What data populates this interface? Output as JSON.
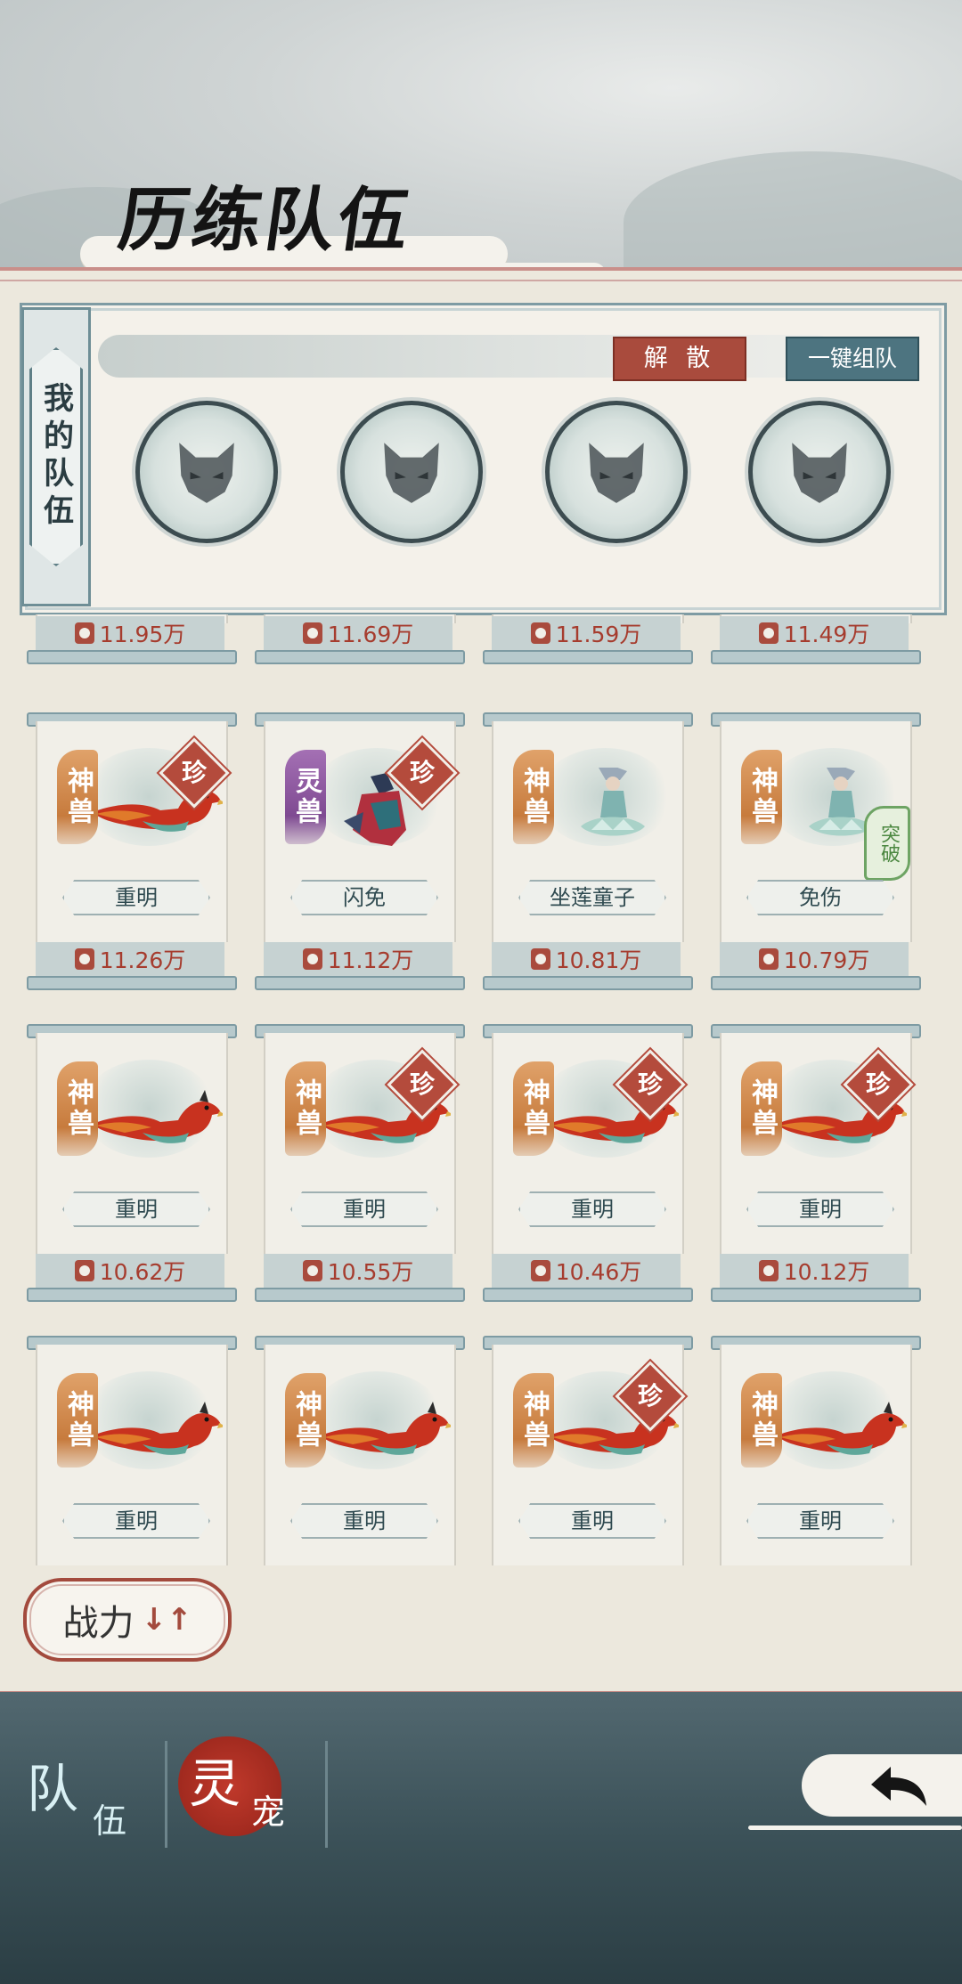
{
  "header": {
    "title": "历练队伍"
  },
  "team": {
    "label": "我的队伍",
    "dissolve_label": "解 散",
    "auto_team_label": "一键组队",
    "slots": [
      {
        "icon": "empty-slot-icon"
      },
      {
        "icon": "empty-slot-icon"
      },
      {
        "icon": "empty-slot-icon"
      },
      {
        "icon": "empty-slot-icon"
      }
    ]
  },
  "top_partial_row": {
    "powers": [
      "11.95万",
      "11.69万",
      "11.59万",
      "11.49万"
    ]
  },
  "pets": [
    {
      "tier": "神兽",
      "tier_color": "orange",
      "name": "重明",
      "rare": "珍",
      "breakthrough": "",
      "power": "11.26万",
      "creature": "phoenix"
    },
    {
      "tier": "灵兽",
      "tier_color": "purple",
      "name": "闪免",
      "rare": "珍",
      "breakthrough": "",
      "power": "11.12万",
      "creature": "warrior"
    },
    {
      "tier": "神兽",
      "tier_color": "orange",
      "name": "坐莲童子",
      "rare": "",
      "breakthrough": "",
      "power": "10.81万",
      "creature": "lotus"
    },
    {
      "tier": "神兽",
      "tier_color": "orange",
      "name": "免伤",
      "rare": "",
      "breakthrough": "突破",
      "power": "10.79万",
      "creature": "lotus"
    },
    {
      "tier": "神兽",
      "tier_color": "orange",
      "name": "重明",
      "rare": "",
      "breakthrough": "",
      "power": "10.62万",
      "creature": "phoenix"
    },
    {
      "tier": "神兽",
      "tier_color": "orange",
      "name": "重明",
      "rare": "珍",
      "breakthrough": "",
      "power": "10.55万",
      "creature": "phoenix"
    },
    {
      "tier": "神兽",
      "tier_color": "orange",
      "name": "重明",
      "rare": "珍",
      "breakthrough": "",
      "power": "10.46万",
      "creature": "phoenix"
    },
    {
      "tier": "神兽",
      "tier_color": "orange",
      "name": "重明",
      "rare": "珍",
      "breakthrough": "",
      "power": "10.12万",
      "creature": "phoenix"
    },
    {
      "tier": "神兽",
      "tier_color": "orange",
      "name": "重明",
      "rare": "",
      "breakthrough": "",
      "power": "",
      "creature": "phoenix"
    },
    {
      "tier": "神兽",
      "tier_color": "orange",
      "name": "重明",
      "rare": "",
      "breakthrough": "",
      "power": "",
      "creature": "phoenix"
    },
    {
      "tier": "神兽",
      "tier_color": "orange",
      "name": "重明",
      "rare": "珍",
      "breakthrough": "",
      "power": "",
      "creature": "phoenix"
    },
    {
      "tier": "神兽",
      "tier_color": "orange",
      "name": "重明",
      "rare": "",
      "breakthrough": "",
      "power": "",
      "creature": "phoenix"
    }
  ],
  "sort": {
    "label": "战力",
    "icon": "sort-arrows-icon"
  },
  "tabs": {
    "team": {
      "big": "队",
      "small": "伍"
    },
    "pet": {
      "big": "灵",
      "small": "宠"
    }
  },
  "back": {
    "icon": "back-arrow-icon"
  }
}
